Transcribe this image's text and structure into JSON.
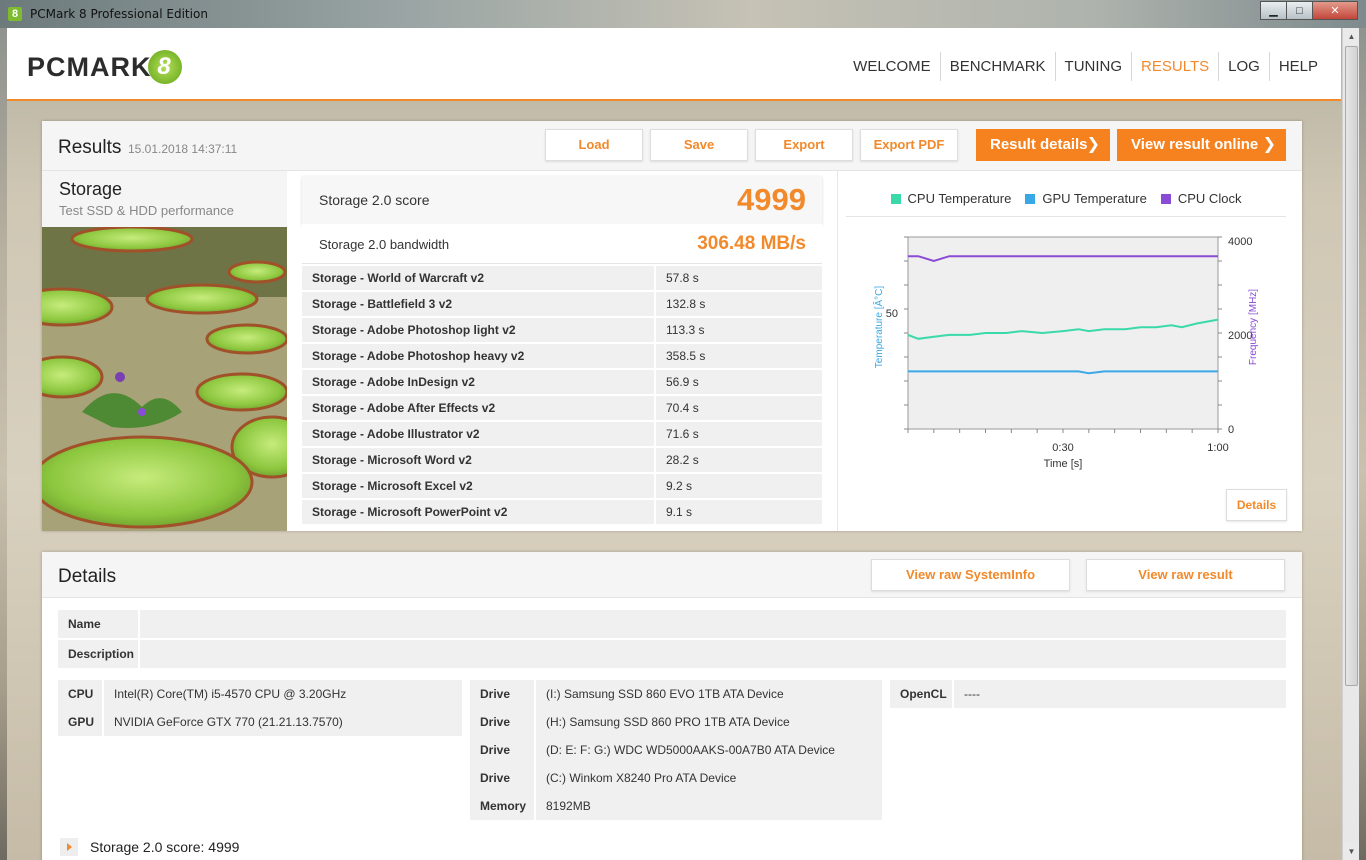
{
  "window": {
    "title": "PCMark 8 Professional Edition",
    "icon_glyph": "8",
    "minimize_glyph": "▁",
    "maximize_glyph": "□",
    "close_glyph": "✕"
  },
  "logo": {
    "text": "PCMARK",
    "eight": "8"
  },
  "nav": [
    {
      "label": "WELCOME",
      "active": false
    },
    {
      "label": "BENCHMARK",
      "active": false
    },
    {
      "label": "TUNING",
      "active": false
    },
    {
      "label": "RESULTS",
      "active": true
    },
    {
      "label": "LOG",
      "active": false
    },
    {
      "label": "HELP",
      "active": false
    }
  ],
  "results": {
    "title": "Results",
    "date": "15.01.2018 14:37:11",
    "buttons": {
      "load": "Load",
      "save": "Save",
      "export": "Export",
      "export_pdf": "Export PDF"
    },
    "result_details": "Result details",
    "view_online": "View result online",
    "chevron": "❯"
  },
  "storage": {
    "name": "Storage",
    "subtitle": "Test SSD & HDD performance"
  },
  "scores": {
    "main_label": "Storage 2.0 score",
    "main_value": "4999",
    "bw_label": "Storage 2.0 bandwidth",
    "bw_value": "306.48 MB/s"
  },
  "subtests": [
    {
      "name": "Storage - World of Warcraft v2",
      "time": "57.8 s"
    },
    {
      "name": "Storage - Battlefield 3 v2",
      "time": "132.8 s"
    },
    {
      "name": "Storage - Adobe Photoshop light v2",
      "time": "113.3 s"
    },
    {
      "name": "Storage - Adobe Photoshop heavy v2",
      "time": "358.5 s"
    },
    {
      "name": "Storage - Adobe InDesign v2",
      "time": "56.9 s"
    },
    {
      "name": "Storage - Adobe After Effects v2",
      "time": "70.4 s"
    },
    {
      "name": "Storage - Adobe Illustrator v2",
      "time": "71.6 s"
    },
    {
      "name": "Storage - Microsoft Word v2",
      "time": "28.2 s"
    },
    {
      "name": "Storage - Microsoft Excel v2",
      "time": "9.2 s"
    },
    {
      "name": "Storage - Microsoft PowerPoint v2",
      "time": "9.1 s"
    }
  ],
  "monitor": {
    "legend": [
      {
        "name": "CPU Temperature",
        "color": "#3ad9a9"
      },
      {
        "name": "GPU Temperature",
        "color": "#3aa8e6"
      },
      {
        "name": "CPU Clock",
        "color": "#8a4bd6"
      }
    ],
    "left_axis_label": "Temperature [Â°C]",
    "right_axis_label": "Frequency [MHz]",
    "x_axis_label": "Time [s]",
    "left_ticks": [
      "50"
    ],
    "right_ticks": [
      "4000",
      "2000",
      "0"
    ],
    "x_ticks": [
      "0:30",
      "1:00"
    ],
    "details_button": "Details"
  },
  "chart_data": {
    "type": "line",
    "xlabel": "Time [s]",
    "xlim": [
      0,
      60
    ],
    "ylim_left": [
      0,
      100
    ],
    "ylim_right": [
      0,
      4000
    ],
    "x": [
      0,
      2,
      5,
      8,
      12,
      15,
      19,
      22,
      26,
      30,
      33,
      35,
      38,
      42,
      45,
      48,
      51,
      53,
      56,
      58,
      60
    ],
    "series": [
      {
        "name": "CPU Temperature",
        "axis": "left",
        "values": [
          49,
          47,
          48,
          49,
          49,
          50,
          50,
          51,
          50,
          51,
          52,
          51,
          52,
          52,
          53,
          53,
          54,
          53,
          55,
          56,
          57
        ]
      },
      {
        "name": "GPU Temperature",
        "axis": "left",
        "values": [
          30,
          30,
          30,
          30,
          30,
          30,
          30,
          30,
          30,
          30,
          30,
          29,
          30,
          30,
          30,
          30,
          30,
          30,
          30,
          30,
          30
        ]
      },
      {
        "name": "CPU Clock",
        "axis": "right",
        "values": [
          3600,
          3600,
          3500,
          3600,
          3600,
          3600,
          3600,
          3600,
          3600,
          3600,
          3600,
          3600,
          3600,
          3600,
          3600,
          3600,
          3600,
          3600,
          3600,
          3600,
          3600
        ]
      }
    ]
  },
  "details": {
    "title": "Details",
    "view_sysinfo": "View raw SystemInfo",
    "view_result": "View raw result",
    "name_label": "Name",
    "name_value": "",
    "description_label": "Description",
    "description_value": "",
    "cpu_label": "CPU",
    "cpu_value": "Intel(R) Core(TM) i5-4570 CPU @ 3.20GHz",
    "gpu_label": "GPU",
    "gpu_value": "NVIDIA GeForce GTX 770 (21.21.13.7570)",
    "drives": [
      {
        "label": "Drive",
        "value": "(I:) Samsung SSD 860 EVO 1TB ATA Device"
      },
      {
        "label": "Drive",
        "value": "(H:) Samsung SSD 860 PRO 1TB ATA Device"
      },
      {
        "label": "Drive",
        "value": "(D: E: F: G:) WDC WD5000AAKS-00A7B0 ATA Device"
      },
      {
        "label": "Drive",
        "value": "(C:) Winkom X8240 Pro ATA Device"
      }
    ],
    "memory_label": "Memory",
    "memory_value": "8192MB",
    "opencl_label": "OpenCL",
    "opencl_value": "----",
    "score_line": "Storage 2.0 score: 4999"
  },
  "scrollbar": {
    "up": "▲",
    "down": "▼"
  }
}
